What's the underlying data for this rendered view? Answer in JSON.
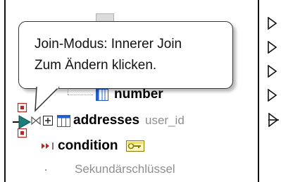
{
  "tooltip": {
    "line1": "Join-Modus: Innerer Join",
    "line2": "Zum Ändern klicken."
  },
  "tree": {
    "number_label": "number",
    "addresses_label": "addresses",
    "addresses_key": "user_id",
    "condition_label": "condition",
    "secondary_key_label": "Sekundärschlüssel"
  },
  "icons": {
    "expand": "plus-box-icon",
    "table": "table-icon",
    "join": "join-bowtie-icon",
    "key": "key-icon",
    "relation": "relation-arrow-icon"
  },
  "colors": {
    "table_icon_blue": "#1f5fd1",
    "relation_red": "#c42020",
    "key_yellow": "#f4d000",
    "connector_teal": "#1a7d7a"
  }
}
